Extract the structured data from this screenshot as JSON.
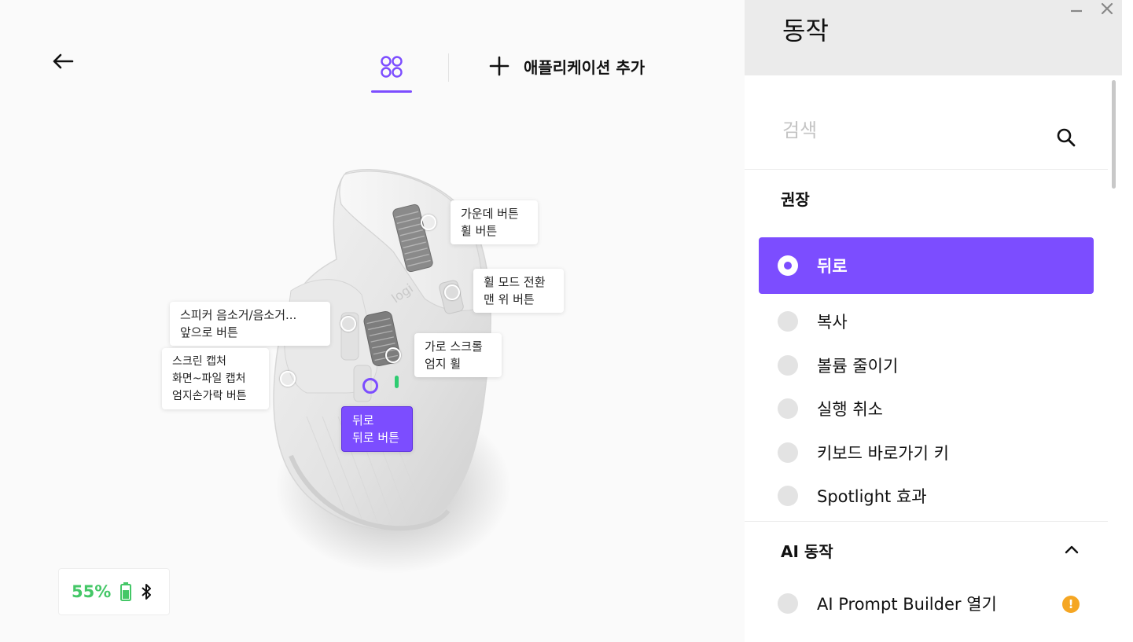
{
  "nav": {
    "add_app_label": "애플리케이션 추가"
  },
  "callouts": {
    "middle": {
      "line1": "가운데 버튼",
      "line2": "휠 버튼"
    },
    "mode_shift": {
      "line1": "휠 모드 전환",
      "line2": "맨 위 버튼"
    },
    "forward": {
      "line1": "스피커 음소거/음소거...",
      "line2": "앞으로 버튼"
    },
    "hscroll": {
      "line1": "가로 스크롤",
      "line2": "엄지 휠"
    },
    "gesture": {
      "line1": "스크린 캡처",
      "line2": "화면~파일 캡처",
      "line3": "엄지손가락 버튼"
    },
    "back": {
      "line1": "뒤로",
      "line2": "뒤로 버튼"
    }
  },
  "device_logo": "logi",
  "battery": {
    "percent": "55%",
    "color": "#44c767"
  },
  "panel": {
    "title": "동작",
    "search_placeholder": "검색",
    "recommended_title": "권장",
    "recommended": [
      {
        "label": "뒤로",
        "selected": true
      },
      {
        "label": "복사",
        "selected": false
      },
      {
        "label": "볼륨 줄이기",
        "selected": false
      },
      {
        "label": "실행 취소",
        "selected": false
      },
      {
        "label": "키보드 바로가기 키",
        "selected": false
      },
      {
        "label": "Spotlight 효과",
        "selected": false
      }
    ],
    "ai_title": "AI 동작",
    "ai_actions": [
      {
        "label": "AI Prompt Builder 열기",
        "warning": "!"
      }
    ]
  },
  "colors": {
    "accent": "#7c4dff",
    "battery": "#44c767",
    "warning": "#f5a623"
  }
}
